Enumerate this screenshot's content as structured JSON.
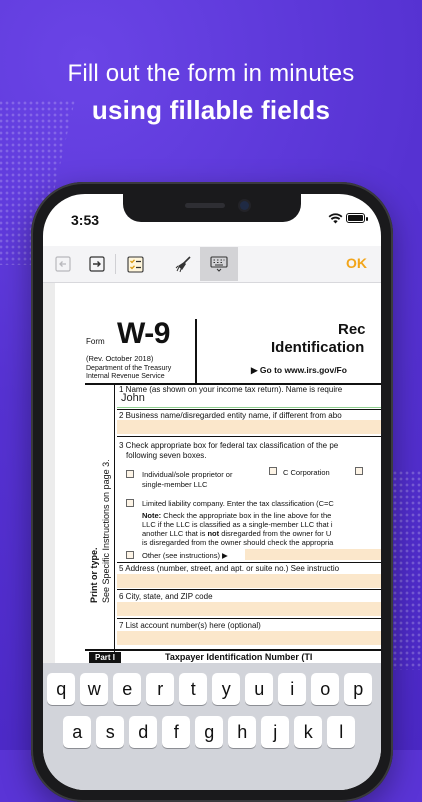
{
  "promo": {
    "line1": "Fill out the form in minutes",
    "line2": "using fillable fields"
  },
  "status_bar": {
    "time": "3:53",
    "icons": [
      "wifi-icon",
      "battery-icon"
    ]
  },
  "toolbar": {
    "buttons": [
      "back-icon",
      "forward-icon",
      "checklist-icon",
      "broom-icon",
      "keyboard-icon"
    ],
    "ok_label": "OK",
    "accent_color": "#f2a51a"
  },
  "form": {
    "form_word": "Form",
    "title": "W-9",
    "revision": "(Rev. October 2018)",
    "dept_line1": "Department of the Treasury",
    "dept_line2": "Internal Revenue Service",
    "heading_1": "Rec",
    "heading_2": "Identification",
    "goto": "▶ Go to www.irs.gov/Fo",
    "side_1": "Print or type.",
    "side_2": "See Specific Instructions on page 3.",
    "field1_label": "1  Name (as shown on your income tax return). Name is require",
    "field1_value": "John",
    "field2_label": "2  Business name/disregarded entity name, if different from abo",
    "field3_label": "3  Check appropriate box for federal tax classification of the pe",
    "field3_label_b": "following seven boxes.",
    "opt_individual_1": "Individual/sole proprietor or",
    "opt_individual_2": "single-member LLC",
    "opt_ccorp": "C Corporation",
    "opt_llc": "Limited liability company. Enter the tax classification (C=C",
    "note_1": "Check the appropriate box in the line above for the",
    "note_label": "Note:",
    "note_2": "LLC if the LLC is classified as a single-member LLC that i",
    "note_3a": "another LLC that is ",
    "note_3b": "not",
    "note_3c": " disregarded from the owner for U",
    "note_4": "is disregarded from the owner should check the appropria",
    "opt_other": "Other (see instructions) ▶",
    "field5_label": "5  Address (number, street, and apt. or suite no.) See instructio",
    "field6_label": "6  City, state, and ZIP code",
    "field7_label": "7  List account number(s) here (optional)",
    "part_label": "Part I",
    "part_title": "Taxpayer Identification Number (TI",
    "field_color": "#fbe7cb"
  },
  "keyboard": {
    "row1": [
      "q",
      "w",
      "e",
      "r",
      "t",
      "y",
      "u",
      "i",
      "o",
      "p"
    ],
    "row2": [
      "a",
      "s",
      "d",
      "f",
      "g",
      "h",
      "j",
      "k",
      "l"
    ]
  }
}
